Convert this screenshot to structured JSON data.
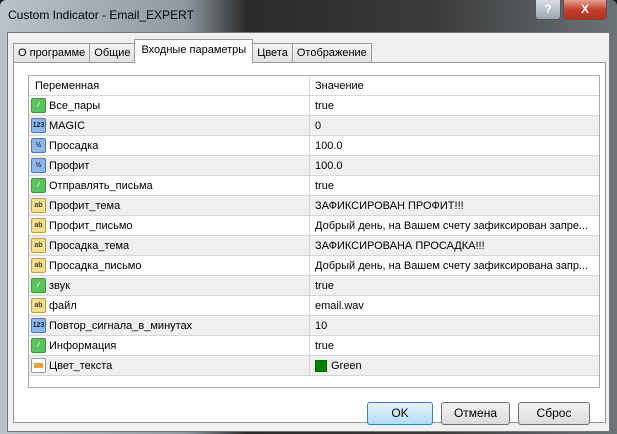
{
  "window": {
    "title": "Custom Indicator - Email_EXPERT",
    "help": "?",
    "close": "X"
  },
  "tabs": [
    "О программе",
    "Общие",
    "Входные параметры",
    "Цвета",
    "Отображение"
  ],
  "active_tab": 2,
  "table": {
    "headers": [
      "Переменная",
      "Значение"
    ],
    "rows": [
      {
        "icon": "bool",
        "name": "Все_пары",
        "value": "true"
      },
      {
        "icon": "int",
        "name": "MAGIC",
        "value": "0"
      },
      {
        "icon": "dbl",
        "name": "Просадка",
        "value": "100.0"
      },
      {
        "icon": "dbl",
        "name": "Профит",
        "value": "100.0"
      },
      {
        "icon": "bool",
        "name": "Отправлять_письма",
        "value": "true"
      },
      {
        "icon": "str",
        "name": "Профит_тема",
        "value": "ЗАФИКСИРОВАН ПРОФИТ!!!"
      },
      {
        "icon": "str",
        "name": "Профит_письмо",
        "value": "Добрый день, на Вашем счету зафиксирован запре..."
      },
      {
        "icon": "str",
        "name": "Просадка_тема",
        "value": "ЗАФИКСИРОВАНА ПРОСАДКА!!!"
      },
      {
        "icon": "str",
        "name": "Просадка_письмо",
        "value": "Добрый день, на Вашем счету зафиксирована запр..."
      },
      {
        "icon": "bool",
        "name": "звук",
        "value": "true"
      },
      {
        "icon": "str",
        "name": "файл",
        "value": "email.wav"
      },
      {
        "icon": "int",
        "name": "Повтор_сигнала_в_минутах",
        "value": "10"
      },
      {
        "icon": "bool",
        "name": "Информация",
        "value": "true"
      },
      {
        "icon": "col",
        "name": "Цвет_текста",
        "value": "Green",
        "swatch": "#008000"
      }
    ]
  },
  "buttons": {
    "ok": "OK",
    "cancel": "Отмена",
    "reset": "Сброс"
  }
}
